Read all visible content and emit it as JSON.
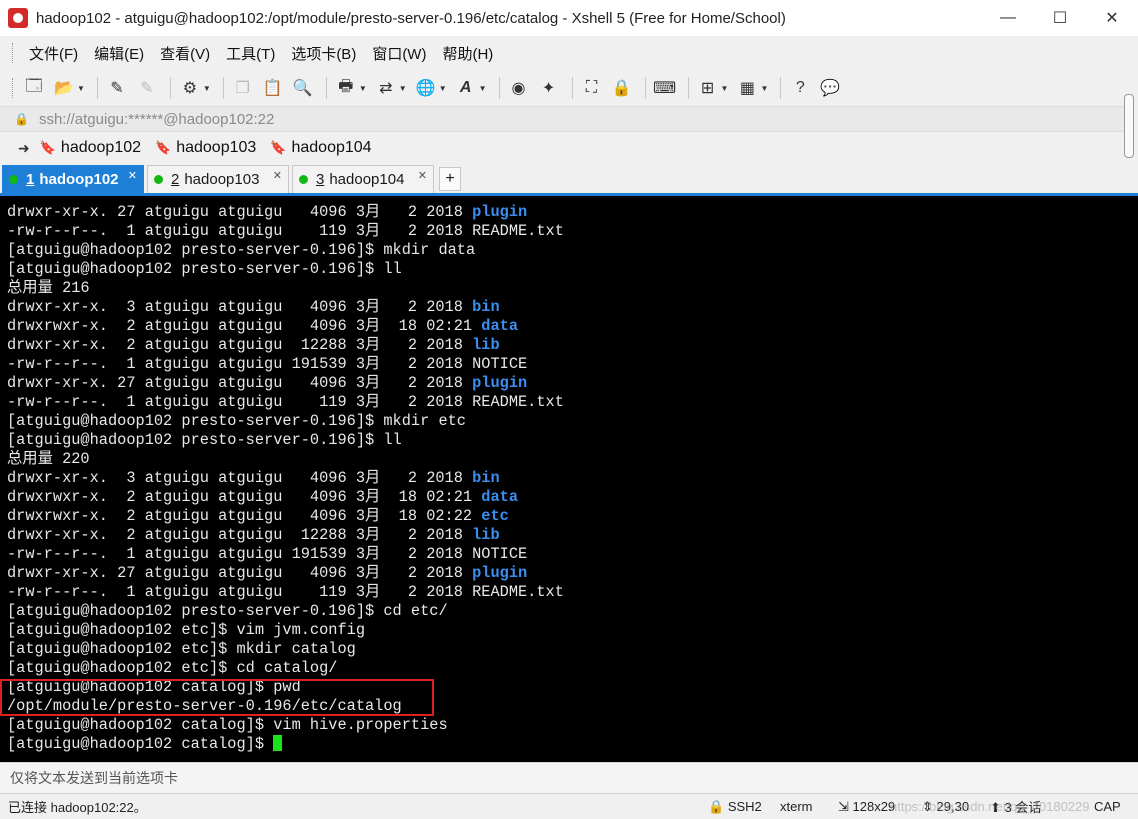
{
  "window": {
    "title": "hadoop102 - atguigu@hadoop102:/opt/module/presto-server-0.196/etc/catalog - Xshell 5 (Free for Home/School)",
    "minimize": "—",
    "maximize": "☐",
    "close": "✕"
  },
  "menu": {
    "items": [
      "文件(F)",
      "编辑(E)",
      "查看(V)",
      "工具(T)",
      "选项卡(B)",
      "窗口(W)",
      "帮助(H)"
    ]
  },
  "toolbar": {
    "icons": [
      "new-session-icon",
      "open-folder-icon",
      "reconnect-icon",
      "disconnect-icon",
      "properties-icon",
      "copy-icon",
      "paste-icon",
      "find-icon",
      "print-icon",
      "transfer-icon",
      "globe-icon",
      "font-icon",
      "xftp-icon",
      "xmanager-icon",
      "fullscreen-icon",
      "lock-icon",
      "keyboard-icon",
      "add-icon",
      "layout-icon",
      "help-icon",
      "chat-icon"
    ]
  },
  "address": {
    "text": "ssh://atguigu:******@hadoop102:22"
  },
  "quick_connect": {
    "items": [
      "hadoop102",
      "hadoop103",
      "hadoop104"
    ]
  },
  "tabs": [
    {
      "num": "1",
      "label": "hadoop102",
      "active": true
    },
    {
      "num": "2",
      "label": "hadoop103",
      "active": false
    },
    {
      "num": "3",
      "label": "hadoop104",
      "active": false
    }
  ],
  "tab_add": "+",
  "terminal": {
    "lines": [
      {
        "text": "drwxr-xr-x. 27 atguigu atguigu   4096 3月   2 2018 ",
        "dir": "plugin"
      },
      {
        "text": "-rw-r--r--.  1 atguigu atguigu    119 3月   2 2018 README.txt",
        "dir": ""
      },
      {
        "text": "[atguigu@hadoop102 presto-server-0.196]$ mkdir data",
        "dir": ""
      },
      {
        "text": "[atguigu@hadoop102 presto-server-0.196]$ ll",
        "dir": ""
      },
      {
        "text": "总用量 216",
        "dir": ""
      },
      {
        "text": "drwxr-xr-x.  3 atguigu atguigu   4096 3月   2 2018 ",
        "dir": "bin"
      },
      {
        "text": "drwxrwxr-x.  2 atguigu atguigu   4096 3月  18 02:21 ",
        "dir": "data"
      },
      {
        "text": "drwxr-xr-x.  2 atguigu atguigu  12288 3月   2 2018 ",
        "dir": "lib"
      },
      {
        "text": "-rw-r--r--.  1 atguigu atguigu 191539 3月   2 2018 NOTICE",
        "dir": ""
      },
      {
        "text": "drwxr-xr-x. 27 atguigu atguigu   4096 3月   2 2018 ",
        "dir": "plugin"
      },
      {
        "text": "-rw-r--r--.  1 atguigu atguigu    119 3月   2 2018 README.txt",
        "dir": ""
      },
      {
        "text": "[atguigu@hadoop102 presto-server-0.196]$ mkdir etc",
        "dir": ""
      },
      {
        "text": "[atguigu@hadoop102 presto-server-0.196]$ ll",
        "dir": ""
      },
      {
        "text": "总用量 220",
        "dir": ""
      },
      {
        "text": "drwxr-xr-x.  3 atguigu atguigu   4096 3月   2 2018 ",
        "dir": "bin"
      },
      {
        "text": "drwxrwxr-x.  2 atguigu atguigu   4096 3月  18 02:21 ",
        "dir": "data"
      },
      {
        "text": "drwxrwxr-x.  2 atguigu atguigu   4096 3月  18 02:22 ",
        "dir": "etc"
      },
      {
        "text": "drwxr-xr-x.  2 atguigu atguigu  12288 3月   2 2018 ",
        "dir": "lib"
      },
      {
        "text": "-rw-r--r--.  1 atguigu atguigu 191539 3月   2 2018 NOTICE",
        "dir": ""
      },
      {
        "text": "drwxr-xr-x. 27 atguigu atguigu   4096 3月   2 2018 ",
        "dir": "plugin"
      },
      {
        "text": "-rw-r--r--.  1 atguigu atguigu    119 3月   2 2018 README.txt",
        "dir": ""
      },
      {
        "text": "[atguigu@hadoop102 presto-server-0.196]$ cd etc/",
        "dir": ""
      },
      {
        "text": "[atguigu@hadoop102 etc]$ vim jvm.config",
        "dir": ""
      },
      {
        "text": "[atguigu@hadoop102 etc]$ mkdir catalog",
        "dir": ""
      },
      {
        "text": "[atguigu@hadoop102 etc]$ cd catalog/",
        "dir": ""
      },
      {
        "text": "[atguigu@hadoop102 catalog]$ pwd",
        "dir": ""
      },
      {
        "text": "/opt/module/presto-server-0.196/etc/catalog",
        "dir": ""
      },
      {
        "text": "[atguigu@hadoop102 catalog]$ vim hive.properties",
        "dir": ""
      },
      {
        "text": "[atguigu@hadoop102 catalog]$ ",
        "dir": "",
        "cursor": true
      }
    ],
    "dir_color": "#3b8ef0",
    "cursor_color": "#19e619"
  },
  "sendbar": {
    "text": "仅将文本发送到当前选项卡"
  },
  "status": {
    "connection": "已连接 hadoop102:22。",
    "protocol": "SSH2",
    "term": "xterm",
    "size": "128x29",
    "position": "29,30",
    "sessions": "3 会话",
    "cap": "CAP",
    "watermark": "https://blog.csdn.net/qq_40180229"
  }
}
